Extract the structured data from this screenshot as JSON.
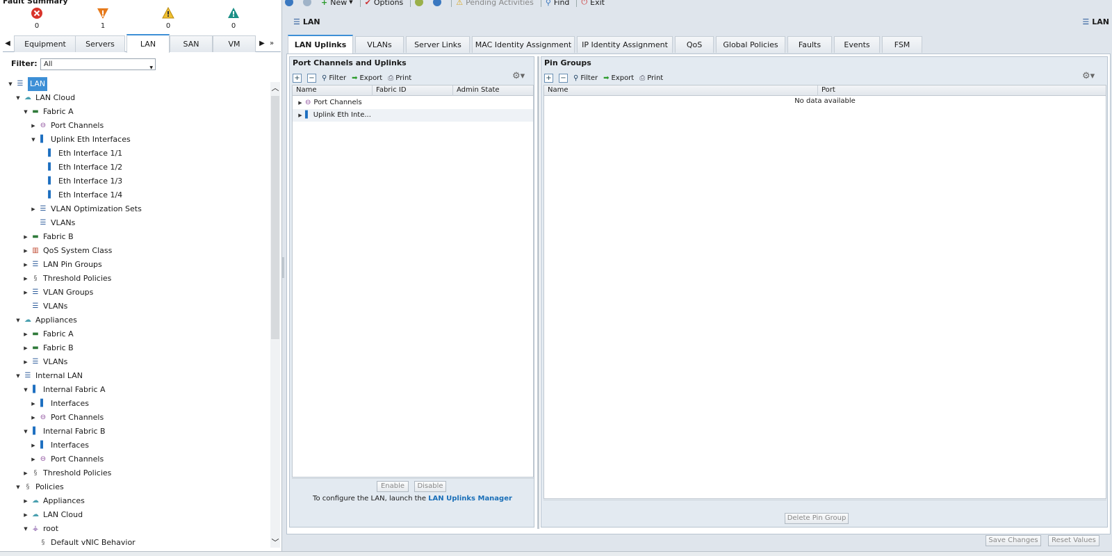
{
  "fault_summary": {
    "title": "Fault Summary",
    "items": [
      {
        "name": "critical",
        "icon": "critical-fault-icon",
        "count": "0",
        "color": "#d9342b"
      },
      {
        "name": "major",
        "icon": "major-fault-icon",
        "count": "1",
        "color": "#e67a1c"
      },
      {
        "name": "minor",
        "icon": "minor-fault-icon",
        "count": "0",
        "color": "#f0c030"
      },
      {
        "name": "warning",
        "icon": "warning-fault-icon",
        "count": "0",
        "color": "#1b8f86"
      }
    ]
  },
  "nav_tabs": [
    {
      "label": "Equipment",
      "active": false
    },
    {
      "label": "Servers",
      "active": false
    },
    {
      "label": "LAN",
      "active": true
    },
    {
      "label": "SAN",
      "active": false
    },
    {
      "label": "VM",
      "active": false
    }
  ],
  "filter": {
    "label": "Filter:",
    "value": "All"
  },
  "tree": [
    {
      "label": "LAN",
      "icon": "lan-icon",
      "toggle": "open",
      "selected": true
    },
    {
      "label": "LAN Cloud",
      "icon": "cloud-icon",
      "toggle": "open"
    },
    {
      "label": "Fabric A",
      "icon": "fabric-icon",
      "toggle": "open"
    },
    {
      "label": "Port Channels",
      "icon": "port-channel-icon",
      "toggle": "closed"
    },
    {
      "label": "Uplink Eth Interfaces",
      "icon": "interface-icon",
      "toggle": "open"
    },
    {
      "label": "Eth Interface 1/1",
      "icon": "interface-icon",
      "toggle": "none"
    },
    {
      "label": "Eth Interface 1/2",
      "icon": "interface-icon",
      "toggle": "none"
    },
    {
      "label": "Eth Interface 1/3",
      "icon": "interface-icon",
      "toggle": "none"
    },
    {
      "label": "Eth Interface 1/4",
      "icon": "interface-icon",
      "toggle": "none"
    },
    {
      "label": "VLAN Optimization Sets",
      "icon": "list-icon",
      "toggle": "closed"
    },
    {
      "label": "VLANs",
      "icon": "list-icon",
      "toggle": "none"
    },
    {
      "label": "Fabric B",
      "icon": "fabric-icon",
      "toggle": "closed"
    },
    {
      "label": "QoS System Class",
      "icon": "qos-icon",
      "toggle": "closed"
    },
    {
      "label": "LAN Pin Groups",
      "icon": "list-icon",
      "toggle": "closed"
    },
    {
      "label": "Threshold Policies",
      "icon": "policy-icon",
      "toggle": "closed"
    },
    {
      "label": "VLAN Groups",
      "icon": "list-icon",
      "toggle": "closed"
    },
    {
      "label": "VLANs",
      "icon": "list-icon",
      "toggle": "none"
    },
    {
      "label": "Appliances",
      "icon": "cloud-icon",
      "toggle": "open"
    },
    {
      "label": "Fabric A",
      "icon": "fabric-icon",
      "toggle": "closed"
    },
    {
      "label": "Fabric B",
      "icon": "fabric-icon",
      "toggle": "closed"
    },
    {
      "label": "VLANs",
      "icon": "list-icon",
      "toggle": "closed"
    },
    {
      "label": "Internal LAN",
      "icon": "list-icon",
      "toggle": "open"
    },
    {
      "label": "Internal Fabric A",
      "icon": "interface-icon",
      "toggle": "open"
    },
    {
      "label": "Interfaces",
      "icon": "interface-icon",
      "toggle": "closed"
    },
    {
      "label": "Port Channels",
      "icon": "port-channel-icon",
      "toggle": "closed"
    },
    {
      "label": "Internal Fabric B",
      "icon": "interface-icon",
      "toggle": "open"
    },
    {
      "label": "Interfaces",
      "icon": "interface-icon",
      "toggle": "closed"
    },
    {
      "label": "Port Channels",
      "icon": "port-channel-icon",
      "toggle": "closed"
    },
    {
      "label": "Threshold Policies",
      "icon": "policy-icon",
      "toggle": "closed"
    },
    {
      "label": "Policies",
      "icon": "policy-icon",
      "toggle": "open"
    },
    {
      "label": "Appliances",
      "icon": "cloud-icon",
      "toggle": "closed"
    },
    {
      "label": "LAN Cloud",
      "icon": "cloud-icon",
      "toggle": "closed"
    },
    {
      "label": "root",
      "icon": "org-icon",
      "toggle": "open"
    },
    {
      "label": "Default vNIC Behavior",
      "icon": "policy-icon",
      "toggle": "none"
    }
  ],
  "toolbar": {
    "new_label": "New",
    "options_label": "Options",
    "pending_label": "Pending Activities",
    "find_label": "Find",
    "exit_label": "Exit"
  },
  "breadcrumb": "LAN",
  "breadcrumb_right": "LAN",
  "content_tabs": [
    {
      "label": "LAN Uplinks",
      "active": true
    },
    {
      "label": "VLANs",
      "active": false
    },
    {
      "label": "Server Links",
      "active": false
    },
    {
      "label": "MAC Identity Assignment",
      "active": false
    },
    {
      "label": "IP Identity Assignment",
      "active": false
    },
    {
      "label": "QoS",
      "active": false
    },
    {
      "label": "Global Policies",
      "active": false
    },
    {
      "label": "Faults",
      "active": false
    },
    {
      "label": "Events",
      "active": false
    },
    {
      "label": "FSM",
      "active": false
    }
  ],
  "uplinks_panel": {
    "title": "Port Channels and Uplinks",
    "filter_label": "Filter",
    "export_label": "Export",
    "print_label": "Print",
    "columns": [
      "Name",
      "Fabric ID",
      "Admin State"
    ],
    "rows": [
      {
        "name": "Port Channels",
        "icon": "port-channel-icon"
      },
      {
        "name": "Uplink Eth Inte...",
        "icon": "interface-icon"
      }
    ],
    "enable_label": "Enable",
    "disable_label": "Disable",
    "config_text": "To configure the LAN, launch the",
    "config_link": "LAN Uplinks Manager"
  },
  "pin_panel": {
    "title": "Pin Groups",
    "filter_label": "Filter",
    "export_label": "Export",
    "print_label": "Print",
    "columns": [
      "Name",
      "Port"
    ],
    "empty_text": "No data available",
    "delete_label": "Delete Pin Group"
  },
  "footer": {
    "save_label": "Save Changes",
    "reset_label": "Reset Values"
  }
}
